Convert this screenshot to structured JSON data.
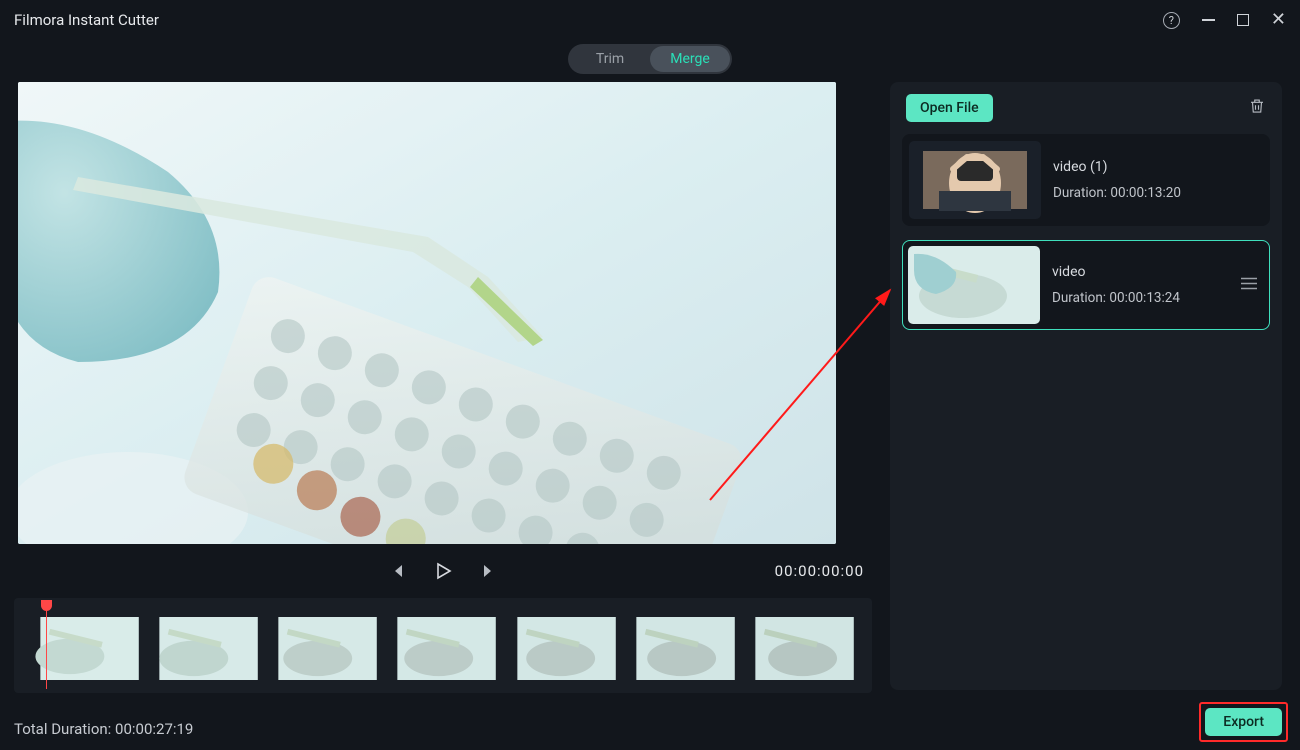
{
  "titlebar": {
    "title": "Filmora Instant Cutter"
  },
  "tabs": {
    "trim": "Trim",
    "merge": "Merge",
    "active": "merge"
  },
  "player": {
    "timecode": "00:00:00:00"
  },
  "sidebar": {
    "open_file_label": "Open File",
    "clips": [
      {
        "name": "video (1)",
        "duration_label": "Duration: 00:00:13:20",
        "selected": false
      },
      {
        "name": "video",
        "duration_label": "Duration: 00:00:13:24",
        "selected": true
      }
    ]
  },
  "footer": {
    "total_duration_label": "Total Duration: 00:00:27:19",
    "export_label": "Export"
  }
}
